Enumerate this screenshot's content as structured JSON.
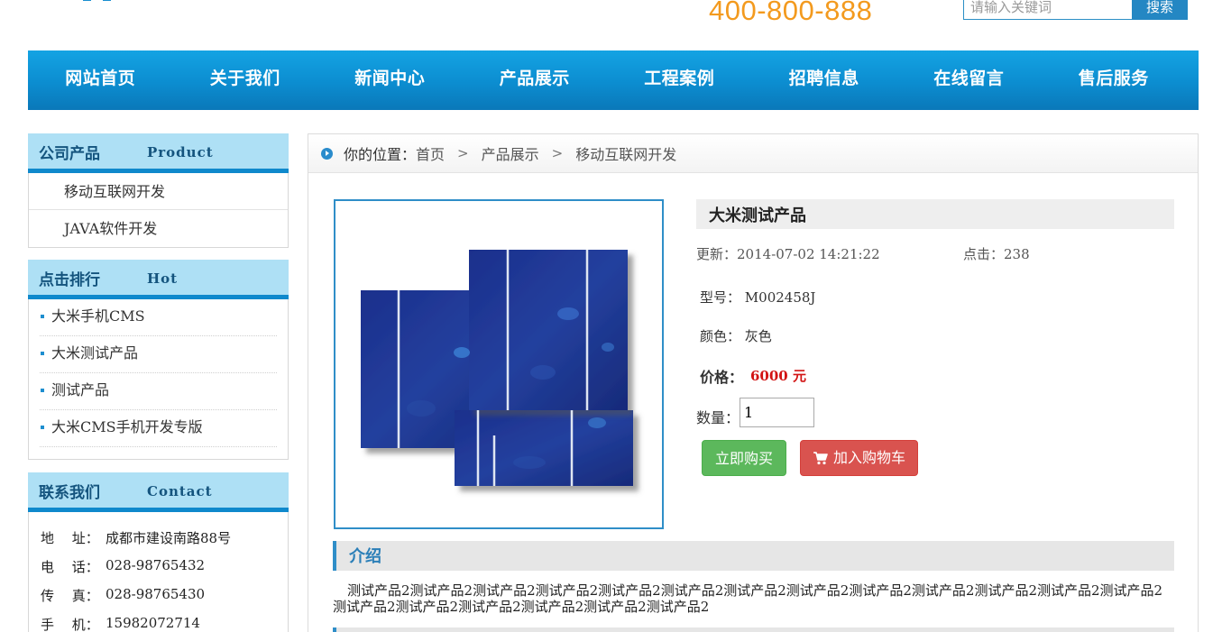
{
  "header": {
    "phone": "400-800-888",
    "search_placeholder": "请输入关键词",
    "search_button": "搜索"
  },
  "nav": {
    "items": [
      "网站首页",
      "关于我们",
      "新闻中心",
      "产品展示",
      "工程案例",
      "招聘信息",
      "在线留言",
      "售后服务"
    ]
  },
  "sidebar": {
    "products": {
      "title": "公司产品",
      "title_en": "Product",
      "items": [
        "移动互联网开发",
        "JAVA软件开发"
      ]
    },
    "hot": {
      "title": "点击排行",
      "title_en": "Hot",
      "items": [
        "大米手机CMS",
        "大米测试产品",
        "测试产品",
        "大米CMS手机开发专版"
      ]
    },
    "contact": {
      "title": "联系我们",
      "title_en": "Contact",
      "rows": [
        {
          "label": "地　 址：",
          "value": "成都市建设南路88号"
        },
        {
          "label": "电　 话：",
          "value": "028-98765432"
        },
        {
          "label": "传　 真：",
          "value": "028-98765430"
        },
        {
          "label": "手　 机：",
          "value": "15982072714"
        }
      ]
    }
  },
  "breadcrumb": {
    "prefix": "你的位置：",
    "items": [
      "首页",
      "产品展示",
      "移动互联网开发"
    ],
    "separator": ">"
  },
  "product": {
    "name": "大米测试产品",
    "updated_label": "更新：",
    "updated": "2014-07-02 14:21:22",
    "hits_label": "点击：",
    "hits": "238",
    "model_label": "型号：",
    "model": "M002458J",
    "color_label": "颜色：",
    "color": "灰色",
    "price_label": "价格：",
    "price": "6000 元",
    "qty_label": "数量：",
    "qty_value": "1",
    "buy_button": "立即购买",
    "cart_button": "加入购物车"
  },
  "intro": {
    "title": "介绍",
    "text": "测试产品2测试产品2测试产品2测试产品2测试产品2测试产品2测试产品2测试产品2测试产品2测试产品2测试产品2测试产品2测试产品2测试产品2测试产品2测试产品2测试产品2测试产品2测试产品2"
  },
  "colors": {
    "nav_blue": "#0c8dd0",
    "accent_orange": "#f39a1e",
    "price_red": "#d21313",
    "buy_green": "#5cb85c",
    "cart_red": "#d9534f"
  },
  "icons": [
    "breadcrumb-arrow-icon",
    "cart-icon",
    "bullet-icon"
  ]
}
